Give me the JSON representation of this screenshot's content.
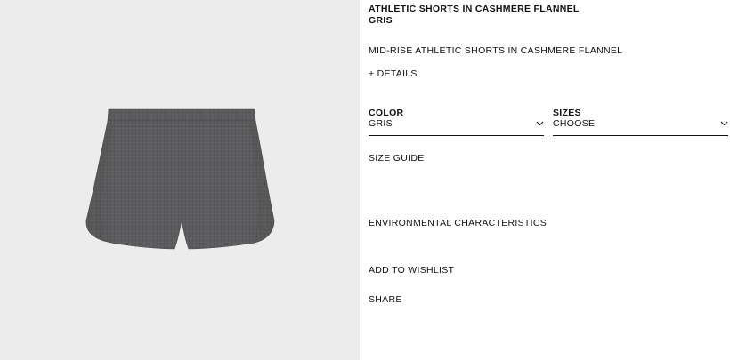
{
  "product": {
    "name": "ATHLETIC SHORTS IN CASHMERE FLANNEL",
    "color_name": "GRIS",
    "description": "MID-RISE ATHLETIC SHORTS IN CASHMERE FLANNEL",
    "details_label": "+ DETAILS",
    "image_color": "#5b5b5d"
  },
  "selectors": {
    "color": {
      "label": "COLOR",
      "value": "GRIS",
      "icon": "chevron-down-icon"
    },
    "sizes": {
      "label": "SIZES",
      "value": "CHOOSE",
      "icon": "chevron-down-icon"
    }
  },
  "links": {
    "size_guide": "SIZE GUIDE",
    "environmental": "ENVIRONMENTAL CHARACTERISTICS",
    "wishlist": "ADD TO WISHLIST",
    "share": "SHARE"
  },
  "colors": {
    "image_background": "#ececec",
    "text": "#111111"
  }
}
